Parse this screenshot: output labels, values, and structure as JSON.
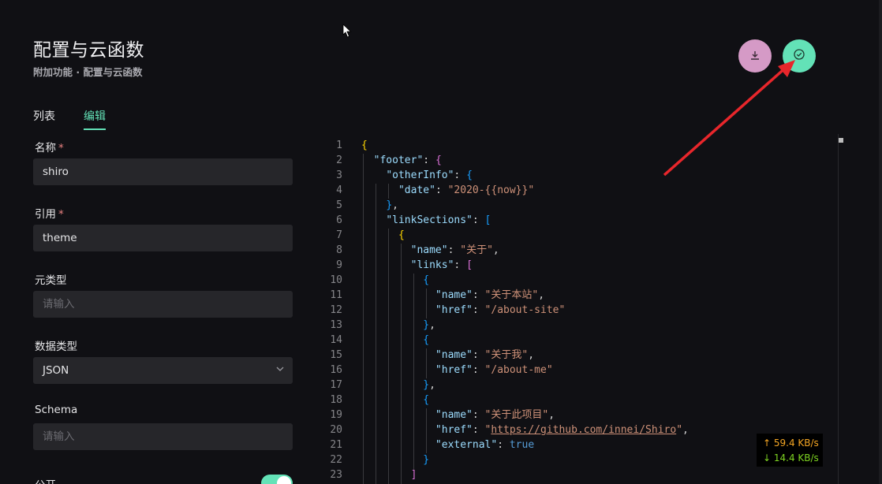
{
  "header": {
    "title": "配置与云函数",
    "breadcrumb": "附加功能 · 配置与云函数"
  },
  "tabs": [
    {
      "label": "列表",
      "active": false
    },
    {
      "label": "编辑",
      "active": true
    }
  ],
  "form": {
    "name_label": "名称",
    "name_value": "shiro",
    "reference_label": "引用",
    "reference_value": "theme",
    "meta_type_label": "元类型",
    "meta_type_placeholder": "请输入",
    "data_type_label": "数据类型",
    "data_type_value": "JSON",
    "schema_label": "Schema",
    "schema_placeholder": "请输入",
    "public_label": "公开",
    "public_on": true,
    "required_mark": "*"
  },
  "actions": {
    "download_icon": "download-icon",
    "save_icon": "check-circle-icon",
    "download_color": "#d59ac6",
    "save_color": "#63e2b7"
  },
  "editor": {
    "line_numbers": [
      "1",
      "2",
      "3",
      "4",
      "5",
      "6",
      "7",
      "8",
      "9",
      "10",
      "11",
      "12",
      "13",
      "14",
      "15",
      "16",
      "17",
      "18",
      "19",
      "20",
      "21",
      "22",
      "23"
    ],
    "s_date": "\"2020-{{now}}\"",
    "s_about": "\"关于\"",
    "s_about_site": "\"关于本站\"",
    "s_about_site_href": "\"/about-site\"",
    "s_about_me": "\"关于我\"",
    "s_about_me_href": "\"/about-me\"",
    "s_project": "\"关于此项目\"",
    "s_project_href": "https://github.com/innei/Shiro",
    "v_true": "true"
  },
  "netspeed": {
    "up": "↑ 59.4 KB/s",
    "down": "↓ 14.4 KB/s"
  },
  "colors": {
    "accent": "#63e2b7",
    "background": "#101014",
    "annotation_arrow": "#e8262b"
  }
}
